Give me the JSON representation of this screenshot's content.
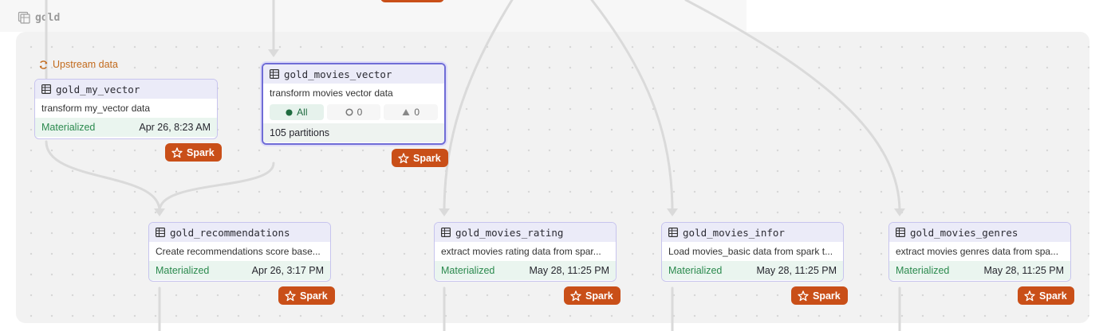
{
  "group": {
    "label": "gold"
  },
  "upstream": {
    "label": "Upstream data"
  },
  "nodes": {
    "gold_my_vector": {
      "name": "gold_my_vector",
      "description": "transform my_vector data",
      "status": "Materialized",
      "timestamp": "Apr 26, 8:23 AM",
      "badge": "Spark"
    },
    "gold_movies_vector": {
      "name": "gold_movies_vector",
      "description": "transform movies vector data",
      "filters": [
        {
          "label": "All",
          "icon": "filled-dot-icon"
        },
        {
          "label": "0",
          "icon": "ring-icon"
        },
        {
          "label": "0",
          "icon": "triangle-icon"
        }
      ],
      "partitions": "105 partitions",
      "badge": "Spark"
    },
    "gold_recommendations": {
      "name": "gold_recommendations",
      "description": "Create recommendations score base...",
      "status": "Materialized",
      "timestamp": "Apr 26, 3:17 PM",
      "badge": "Spark"
    },
    "gold_movies_rating": {
      "name": "gold_movies_rating",
      "description": "extract movies rating data from spar...",
      "status": "Materialized",
      "timestamp": "May 28, 11:25 PM",
      "badge": "Spark"
    },
    "gold_movies_infor": {
      "name": "gold_movies_infor",
      "description": "Load movies_basic data from spark t...",
      "status": "Materialized",
      "timestamp": "May 28, 11:25 PM",
      "badge": "Spark"
    },
    "gold_movies_genres": {
      "name": "gold_movies_genres",
      "description": "extract movies genres data from spa...",
      "status": "Materialized",
      "timestamp": "May 28, 11:25 PM",
      "badge": "Spark"
    }
  },
  "colors": {
    "node_border": "#c7c4ee",
    "selected_border": "#6f6cd6",
    "header_bg": "#ebebf8",
    "materialized": "#2b8a4e",
    "spark_badge": "#c94f18",
    "upstream": "#c26a1c"
  }
}
